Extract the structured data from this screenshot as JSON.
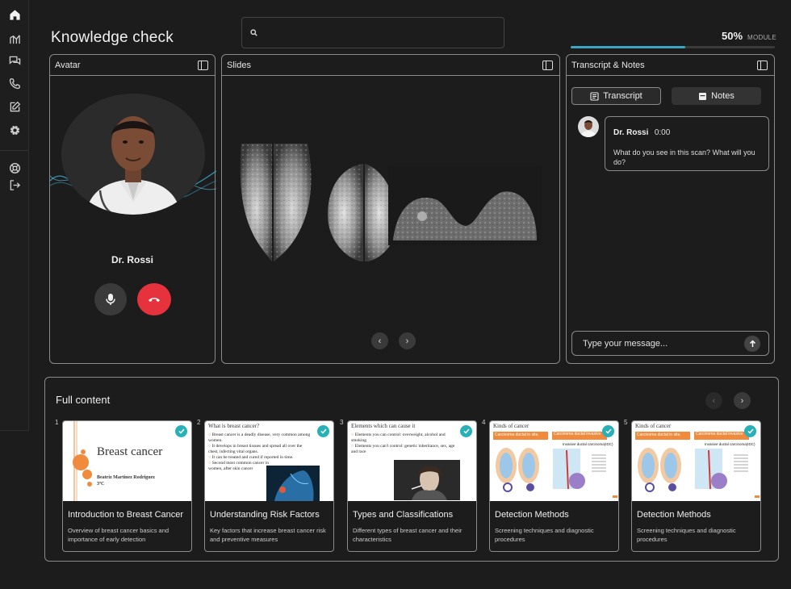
{
  "header": {
    "title": "Knowledge check",
    "search_placeholder": "",
    "progress_percent": "50%",
    "progress_label": "MODULE",
    "progress_value": 0.56
  },
  "sidebar": {
    "items": [
      "home-icon",
      "analytics-icon",
      "chat-icon",
      "phone-icon",
      "edit-icon",
      "settings-icon",
      "support-icon",
      "logout-icon"
    ]
  },
  "avatar_panel": {
    "title": "Avatar",
    "name": "Dr. Rossi"
  },
  "slides_panel": {
    "title": "Slides"
  },
  "transcript_panel": {
    "title": "Transcript & Notes",
    "tabs": [
      "Transcript",
      "Notes"
    ],
    "messages": [
      {
        "name": "Dr. Rossi",
        "time": "0:00",
        "text": "What do you see in this scan? What will you do?"
      }
    ],
    "input_placeholder": "Type your message..."
  },
  "full_content": {
    "title": "Full content",
    "cards": [
      {
        "num": "1",
        "title": "Introduction to Breast Cancer",
        "desc": "Overview of breast cancer basics and importance of early detection",
        "thumb_title": "Breast cancer",
        "thumb_author": "Beatriz Martinez Rodriguez",
        "thumb_sub": "3ºC"
      },
      {
        "num": "2",
        "title": "Understanding Risk Factors",
        "desc": "Key factors that increase breast cancer risk and preventive measures",
        "thumb_title": "What is breast cancer?",
        "thumb_bullets": [
          "Breast cancer is a deadly disease, very common among women.",
          "It develops in breast tissues and spread all over the chest, infecting vital organs.",
          "It can be treated and cured if reported in time.",
          "Second most common cancer in women, after skin cancer"
        ]
      },
      {
        "num": "3",
        "title": "Types and Classifications",
        "desc": "Different types of breast cancer and their characteristics",
        "thumb_title": "Elements which can cause it",
        "thumb_bullets": [
          "Elements you can control: overweight, alcohol and smoking",
          "Elements you can't control: genetic inheritance, sex, age and race"
        ]
      },
      {
        "num": "4",
        "title": "Detection Methods",
        "desc": "Screening techniques and diagnostic procedures",
        "thumb_title": "Kinds of cancer",
        "thumb_labels": [
          "Carcinoma ductal in situ",
          "Carcinoma ductal invasivo",
          "Invasive ductal carcinoma(IDC)"
        ]
      },
      {
        "num": "5",
        "title": "Detection Methods",
        "desc": "Screening techniques and diagnostic procedures",
        "thumb_title": "Kinds of cancer",
        "thumb_labels": [
          "Carcinoma ductal in situ",
          "Carcinoma ductal invasivo",
          "Invasive ductal carcinoma(IDC)"
        ]
      }
    ]
  },
  "colors": {
    "accent": "#3aa6c4",
    "end_call": "#e6323c",
    "check": "#28b0b8",
    "slide_orange": "#f08a3c"
  }
}
